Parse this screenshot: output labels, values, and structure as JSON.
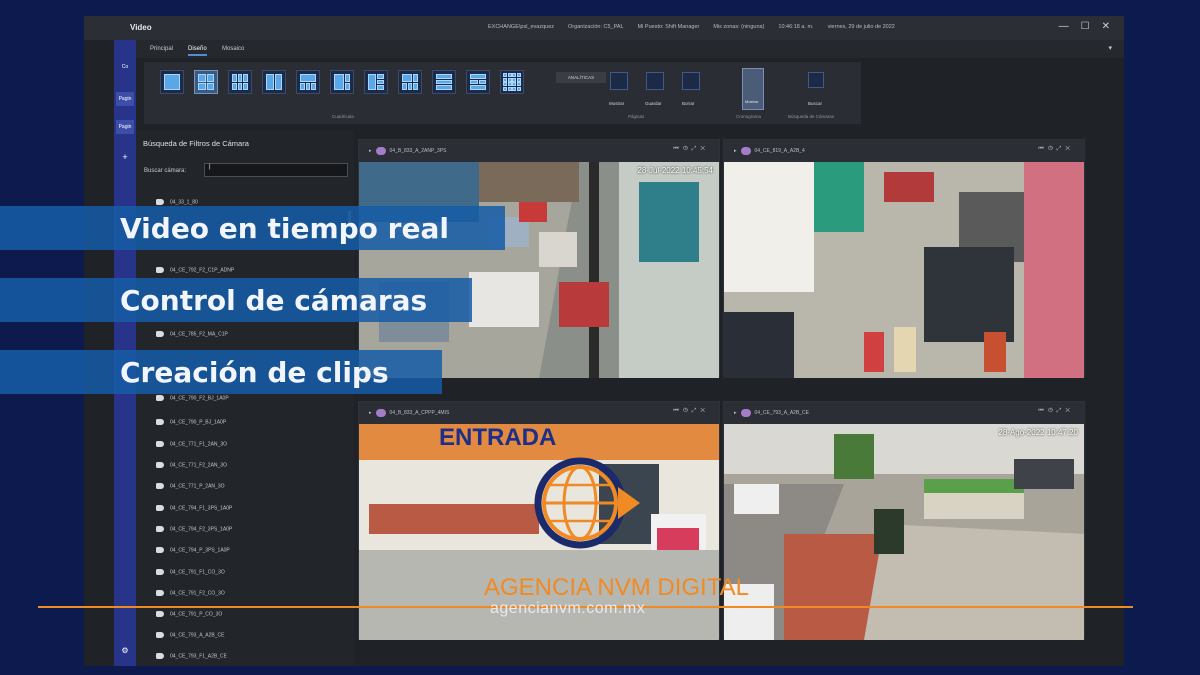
{
  "app": {
    "title": "Video",
    "title_info": {
      "user": "EXCHANGE\\psl_evazquez",
      "organization": "Organización: C5_PAL",
      "position": "Mi Puesto: Shift Manager",
      "timezone": "Mis zonas: (ninguna)",
      "time": "10:46:18 a. m.",
      "date": "viernes, 29 de julio de 2022"
    },
    "window_controls": [
      "—",
      "☐",
      "✕"
    ]
  },
  "left_rail": {
    "items": [
      "Co",
      "Pagin",
      "Pagin",
      "+",
      "⚙"
    ]
  },
  "tabs": [
    {
      "label": "Principal"
    },
    {
      "label": "Diseño",
      "active": true
    },
    {
      "label": "Mosaico"
    }
  ],
  "ribbon": {
    "layout_caption": "Cuadrícula",
    "analiticas": "ANALÍTICAS",
    "pages": [
      {
        "label": "Mostrar"
      },
      {
        "label": "Guardar"
      },
      {
        "label": "Borrar"
      }
    ],
    "pages_caption": "Páginas",
    "cronograma_btn": "Mostrar",
    "cronograma_caption": "Cronograma",
    "search_btn": "Buscar",
    "search_caption": "Búsqueda de Cámaras"
  },
  "filter_panel": {
    "title": "Búsqueda de Filtros de Cámara",
    "search_label": "Buscar cámara:",
    "search_value": "|",
    "cameras": [
      "04_33_1_80",
      "04_CE_792_F2_C1P_ADNP",
      "04_CE_785_F2_MA_C1P",
      "04_CE_790_F2_BJ_1A0P",
      "04_CE_790_P_BJ_1A0P",
      "04_CE_771_F1_2AN_3O",
      "04_CE_771_F2_2AN_3O",
      "04_CE_771_P_2AN_3O",
      "04_CE_794_F1_3PS_1A0P",
      "04_CE_794_F2_3PS_1A0P",
      "04_CE_794_P_3PS_1A0P",
      "04_CE_791_F1_CO_3O",
      "04_CE_791_F2_CO_3O",
      "04_CE_791_P_CO_3O",
      "04_CE_793_A_A2B_CE",
      "04_CE_793_F1_A2B_CE"
    ]
  },
  "video_tiles": [
    {
      "camera": "04_B_833_A_2ANP_3PS",
      "stamp": "28-Jul-2022 10:45:54"
    },
    {
      "camera": "04_CE_819_A_A2B_4",
      "stamp": ""
    },
    {
      "camera": "04_B_833_A_CPPP_4MIS",
      "stamp": "",
      "sign": "ENTRADA"
    },
    {
      "camera": "04_CE_793_A_A2B_CE",
      "stamp": "28-Ago-2022 10:47:20"
    }
  ],
  "banners": [
    "Video en tiempo real",
    "Control de cámaras",
    "Creación de clips"
  ],
  "watermark": {
    "name": "AGENCIA NVM DIGITAL",
    "url": "agencianvm.com.mx",
    "orange": "#f08a24",
    "navy": "#1b2a6a"
  },
  "colors": {
    "background": "#0d1a4e",
    "banner": "#165ca6",
    "accent_blue": "#4a8fd8"
  }
}
